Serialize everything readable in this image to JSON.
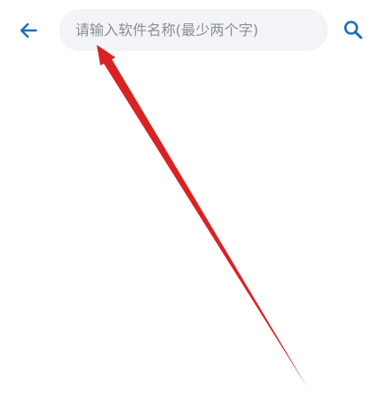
{
  "header": {
    "back_icon": "arrow-left-icon",
    "search": {
      "placeholder": "请输入软件名称(最少两个字)",
      "value": ""
    },
    "search_icon": "search-icon"
  },
  "colors": {
    "accent": "#1f6fb5",
    "search_bg": "#f2f4f7",
    "placeholder": "#8a8f96",
    "annotation_arrow": "#d92323"
  }
}
